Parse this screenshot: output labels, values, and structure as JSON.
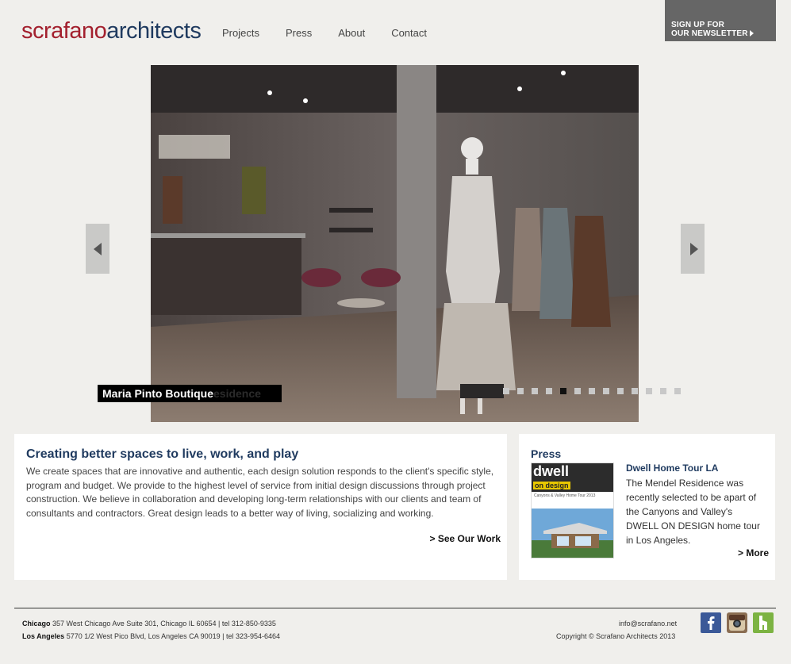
{
  "header": {
    "logo_part1": "scrafano",
    "logo_part2": "architects",
    "nav": [
      "Projects",
      "Press",
      "About",
      "Contact"
    ],
    "newsletter_line1": "SIGN UP FOR",
    "newsletter_line2": "OUR NEWSLETTER"
  },
  "slider": {
    "caption": "Maria Pinto Boutique",
    "caption_ghost": "esidence",
    "slide_count": 13,
    "active_index": 4
  },
  "about": {
    "title": "Creating better spaces to live, work, and play",
    "body": "We create spaces that are innovative and authentic, each design solution responds to the client's specific style, program and budget. We provide to the highest level of service from initial design discussions through project construction. We believe in collaboration and developing long-term relationships with our clients and team of consultants and contractors. Great design leads to a better way of living, socializing and working.",
    "link": "> See Our Work"
  },
  "press": {
    "heading": "Press",
    "item_title": "Dwell Home Tour LA",
    "item_text": "The Mendel Residence was recently selected to be apart of the Canyons and Valley's DWELL ON DESIGN home tour in Los Angeles.",
    "link": "> More",
    "thumb_brand": "dwell",
    "thumb_sub": "on design",
    "thumb_line": "Canyons & Valley Home Tour 2013"
  },
  "footer": {
    "chicago_label": "Chicago",
    "chicago_text": " 357 West Chicago Ave Suite 301, Chicago IL 60654 | tel 312-850-9335",
    "la_label": "Los Angeles",
    "la_text": " 5770 1/2 West Pico Blvd, Los Angeles CA 90019 | tel 323-954-6464",
    "email": "info@scrafano.net",
    "copyright": "Copyright © Scrafano Architects 2013"
  },
  "colors": {
    "brand_red": "#a3202e",
    "brand_blue": "#1f3a5f",
    "background": "#f0efec"
  }
}
